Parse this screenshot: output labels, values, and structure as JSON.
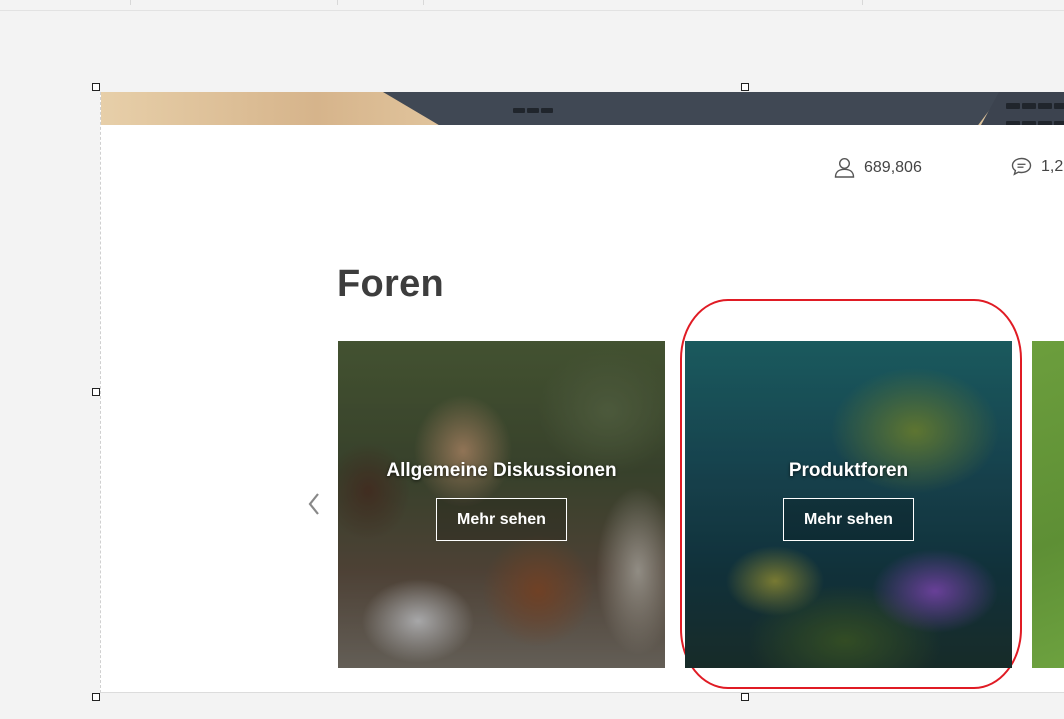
{
  "stats": {
    "members_value": "689,806",
    "posts_value": "1,2"
  },
  "section": {
    "title": "Foren"
  },
  "cards": [
    {
      "title": "Allgemeine Diskussionen",
      "button_label": "Mehr sehen"
    },
    {
      "title": "Produktforen",
      "button_label": "Mehr sehen"
    }
  ],
  "colors": {
    "annotation": "#e01b24",
    "title_text": "#3d3d3d"
  }
}
